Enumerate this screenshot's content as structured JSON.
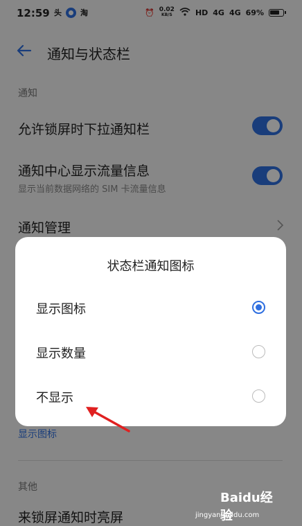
{
  "status_bar": {
    "time": "12:59",
    "left_icons": [
      "头",
      "淘"
    ],
    "speed_value": "0.02",
    "speed_unit": "KB/S",
    "hd": "HD",
    "signal1": "4G",
    "signal2": "4G",
    "battery": "69%"
  },
  "header": {
    "title": "通知与状态栏"
  },
  "sections": {
    "notify_label": "通知",
    "other_label": "其他"
  },
  "rows": {
    "allow_pull": "允许锁屏时下拉通知栏",
    "traffic_title": "通知中心显示流量信息",
    "traffic_sub": "显示当前数据网络的 SIM 卡流量信息",
    "manage": "通知管理",
    "status_icon_value": "显示图标",
    "bottom": "来锁屏通知时亮屏"
  },
  "dialog": {
    "title": "状态栏通知图标",
    "options": [
      {
        "label": "显示图标",
        "selected": true
      },
      {
        "label": "显示数量",
        "selected": false
      },
      {
        "label": "不显示",
        "selected": false
      }
    ]
  },
  "watermark": {
    "logo": "Baidu经验",
    "url": "jingyan.baidu.com"
  },
  "colors": {
    "accent": "#2f6fe0",
    "arrow": "#e02020"
  }
}
